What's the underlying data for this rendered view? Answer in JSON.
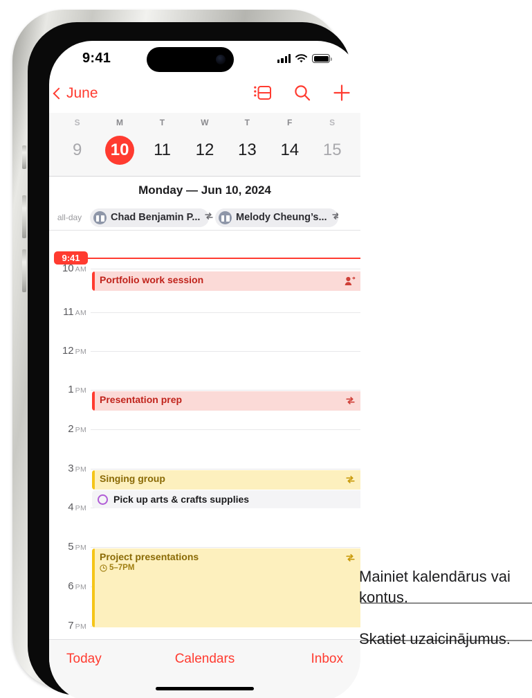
{
  "status_bar": {
    "time": "9:41",
    "cellular_icon": "cellular-bars-icon",
    "wifi_icon": "wifi-icon",
    "battery_icon": "battery-icon"
  },
  "nav_bar": {
    "back_label": "June",
    "back_icon": "chevron-left-icon",
    "list_view_icon": "list-view-icon",
    "search_icon": "search-icon",
    "add_icon": "plus-icon"
  },
  "week_strip": {
    "day_letters": [
      "S",
      "M",
      "T",
      "W",
      "T",
      "F",
      "S"
    ],
    "dates": [
      {
        "num": "9",
        "state": "dim"
      },
      {
        "num": "10",
        "state": "today"
      },
      {
        "num": "11",
        "state": "normal"
      },
      {
        "num": "12",
        "state": "normal"
      },
      {
        "num": "13",
        "state": "normal"
      },
      {
        "num": "14",
        "state": "normal"
      },
      {
        "num": "15",
        "state": "dim"
      }
    ]
  },
  "day_header": {
    "title": "Monday — Jun 10, 2024"
  },
  "all_day": {
    "label": "all-day",
    "chips": [
      {
        "title": "Chad Benjamin P...",
        "icon": "gift-icon",
        "repeat_icon": "repeat-icon"
      },
      {
        "title": "Melody Cheung’s...",
        "icon": "gift-icon",
        "repeat_icon": "repeat-icon"
      }
    ]
  },
  "timeline": {
    "current_time_badge": "9:41",
    "hours": [
      {
        "label": "10",
        "meridiem": "AM"
      },
      {
        "label": "11",
        "meridiem": "AM"
      },
      {
        "label": "12",
        "meridiem": "PM"
      },
      {
        "label": "1",
        "meridiem": "PM"
      },
      {
        "label": "2",
        "meridiem": "PM"
      },
      {
        "label": "3",
        "meridiem": "PM"
      },
      {
        "label": "4",
        "meridiem": "PM"
      },
      {
        "label": "5",
        "meridiem": "PM"
      },
      {
        "label": "6",
        "meridiem": "PM"
      },
      {
        "label": "7",
        "meridiem": "PM"
      }
    ],
    "events": [
      {
        "title": "Portfolio work session",
        "subtitle": "",
        "color": "red",
        "trailing_icon": "attendee-icon"
      },
      {
        "title": "Presentation prep",
        "subtitle": "",
        "color": "red",
        "trailing_icon": "repeat-icon"
      },
      {
        "title": "Singing group",
        "subtitle": "",
        "color": "yellow",
        "trailing_icon": "repeat-icon"
      },
      {
        "title": "Project presentations",
        "subtitle": "5–7PM",
        "color": "yellow",
        "trailing_icon": "repeat-icon"
      }
    ],
    "reminder": {
      "title": "Pick up arts & crafts supplies",
      "icon": "reminder-circle-icon"
    }
  },
  "tab_bar": {
    "today_label": "Today",
    "calendars_label": "Calendars",
    "inbox_label": "Inbox"
  },
  "callouts": [
    {
      "text": "Mainiet kalendārus vai kontus."
    },
    {
      "text": "Skatiet uzaicinājumus."
    }
  ],
  "colors": {
    "accent_red": "#FF3B30",
    "event_red_bg": "#FBDAD7",
    "event_yellow_bg": "#FDF0BE",
    "yellow_bar": "#F5C518",
    "reminder_purple": "#B05CD6"
  }
}
